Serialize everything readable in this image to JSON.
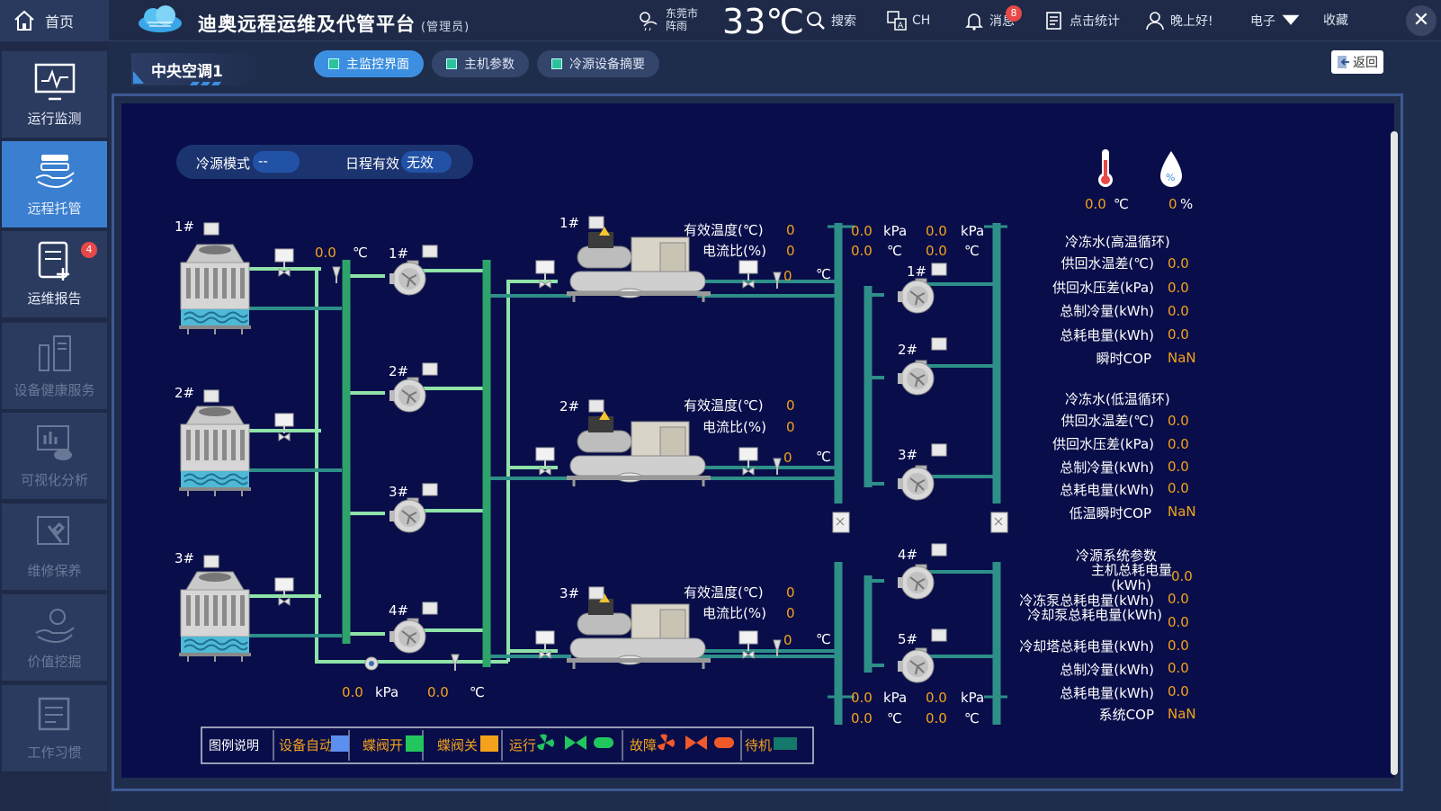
{
  "topbar": {
    "home_label": "首页",
    "app_title": "迪奥远程运维及代管平台",
    "role": "(管理员)",
    "city_line1": "东莞市",
    "city_line2": "阵雨",
    "temperature": "33℃",
    "search_label": "搜索",
    "lang_label": "CH",
    "message_label": "消息",
    "message_count": "8",
    "stats_label": "点击统计",
    "greeting": "晚上好!",
    "user_name": "电子",
    "favorite_label": "收藏",
    "close_label": "✕"
  },
  "sidebar": {
    "items": [
      {
        "label": "运行监测",
        "icon": "monitor-pulse-icon"
      },
      {
        "label": "远程托管",
        "icon": "hand-server-icon"
      },
      {
        "label": "运维报告",
        "icon": "report-add-icon",
        "badge": "4"
      },
      {
        "label": "设备健康服务",
        "icon": "device-health-icon"
      },
      {
        "label": "可视化分析",
        "icon": "visual-analysis-icon"
      },
      {
        "label": "维修保养",
        "icon": "maintenance-icon"
      },
      {
        "label": "价值挖掘",
        "icon": "value-mining-icon"
      },
      {
        "label": "工作习惯",
        "icon": "work-habit-icon"
      }
    ]
  },
  "header": {
    "system_title": "中央空调1",
    "tabs": [
      {
        "label": "主监控界面"
      },
      {
        "label": "主机参数"
      },
      {
        "label": "冷源设备摘要"
      }
    ],
    "back_label": "返回"
  },
  "mode": {
    "source_mode_label": "冷源模式",
    "source_mode_value": "--",
    "schedule_label": "日程有效",
    "schedule_value": "无效"
  },
  "env": {
    "temp_value": "0.0",
    "temp_unit": "℃",
    "humidity_value": "0",
    "humidity_unit": "%"
  },
  "towers": [
    {
      "label": "1#"
    },
    {
      "label": "2#"
    },
    {
      "label": "3#"
    }
  ],
  "cooling_pumps": [
    {
      "label": "1#"
    },
    {
      "label": "2#"
    },
    {
      "label": "3#"
    },
    {
      "label": "4#"
    }
  ],
  "chillers": [
    {
      "label": "1#",
      "eff_temp_label": "有效温度(℃)",
      "eff_temp": "0",
      "current_label": "电流比(%)",
      "current": "0",
      "out_temp": "0",
      "unit": "℃"
    },
    {
      "label": "2#",
      "eff_temp_label": "有效温度(℃)",
      "eff_temp": "0",
      "current_label": "电流比(%)",
      "current": "0",
      "out_temp": "0",
      "unit": "℃"
    },
    {
      "label": "3#",
      "eff_temp_label": "有效温度(℃)",
      "eff_temp": "0",
      "current_label": "电流比(%)",
      "current": "0",
      "out_temp": "0",
      "unit": "℃"
    }
  ],
  "chilled_pumps": [
    {
      "label": "1#"
    },
    {
      "label": "2#"
    },
    {
      "label": "3#"
    },
    {
      "label": "4#"
    },
    {
      "label": "5#"
    }
  ],
  "readings": {
    "tower_out_temp": "0.0",
    "tower_out_unit": "℃",
    "bottom_kpa": "0.0",
    "bottom_kpa_unit": "kPa",
    "bottom_temp": "0.0",
    "bottom_temp_unit": "℃",
    "top_left_kpa": "0.0",
    "top_left_temp": "0.0",
    "top_right_kpa": "0.0",
    "top_right_temp": "0.0",
    "bot_left_kpa": "0.0",
    "bot_left_temp": "0.0",
    "bot_right_kpa": "0.0",
    "bot_right_temp": "0.0",
    "kpa_unit": "kPa",
    "c_unit": "℃"
  },
  "right_panel": {
    "high_title": "冷冻水(高温循环)",
    "high_rows": [
      {
        "label": "供回水温差(℃)",
        "value": "0.0"
      },
      {
        "label": "供回水压差(kPa)",
        "value": "0.0"
      },
      {
        "label": "总制冷量(kWh)",
        "value": "0.0"
      },
      {
        "label": "总耗电量(kWh)",
        "value": "0.0"
      },
      {
        "label": "瞬时COP",
        "value": "NaN"
      }
    ],
    "low_title": "冷冻水(低温循环)",
    "low_rows": [
      {
        "label": "供回水温差(℃)",
        "value": "0.0"
      },
      {
        "label": "供回水压差(kPa)",
        "value": "0.0"
      },
      {
        "label": "总制冷量(kWh)",
        "value": "0.0"
      },
      {
        "label": "总耗电量(kWh)",
        "value": "0.0"
      },
      {
        "label": "低温瞬时COP",
        "value": "NaN"
      }
    ],
    "sys_title": "冷源系统参数",
    "sys_rows": [
      {
        "label": "主机总耗电量",
        "label2": "(kWh)",
        "value": "0.0"
      },
      {
        "label": "冷冻泵总耗电量(kWh)",
        "value": "0.0"
      },
      {
        "label": "冷却泵总耗电量(kWh)",
        "value": "0.0"
      },
      {
        "label": "冷却塔总耗电量(kWh)",
        "value": "0.0"
      },
      {
        "label": "总制冷量(kWh)",
        "value": "0.0"
      },
      {
        "label": "总耗电量(kWh)",
        "value": "0.0"
      },
      {
        "label": "系统COP",
        "value": "NaN"
      }
    ]
  },
  "legend": {
    "title": "图例说明",
    "items": [
      {
        "label": "设备自动",
        "color": "#5b8ff0"
      },
      {
        "label": "蝶阀开",
        "color": "#22c55e"
      },
      {
        "label": "蝶阀关",
        "color": "#f4a21b"
      },
      {
        "label": "运行",
        "color": "#22c55e"
      },
      {
        "label": "故障",
        "color": "#f05a2a"
      },
      {
        "label": "待机",
        "color": "#14786a"
      }
    ]
  },
  "colors": {
    "pipe_light": "#8fe3a8",
    "pipe_teal": "#2d8f88",
    "value_orange": "#f4a21b",
    "accent_blue": "#3c8fe0"
  }
}
